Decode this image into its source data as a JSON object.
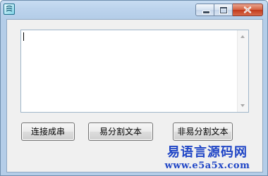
{
  "window": {
    "controls": {
      "minimize": "minimize-icon",
      "maximize": "maximize-icon",
      "close": "close-icon"
    }
  },
  "textbox": {
    "value": ""
  },
  "buttons": {
    "connect_label": "连接成串",
    "split_label": "易分割文本",
    "nonsplit_label": "非易分割文本"
  },
  "watermark": {
    "title": "易语言源码网",
    "url": "www.e5a5x.com"
  },
  "colors": {
    "title_gradient": "#bcd3ec",
    "client_bg": "#f0f0f0",
    "close_red": "#c1391b",
    "watermark_blue": "#2046c6"
  }
}
